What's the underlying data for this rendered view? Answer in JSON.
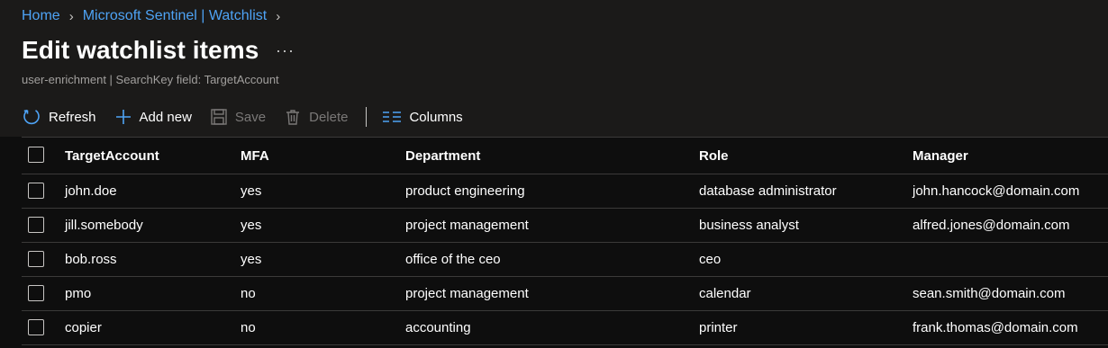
{
  "breadcrumb": {
    "items": [
      "Home",
      "Microsoft Sentinel | Watchlist"
    ]
  },
  "page": {
    "title": "Edit watchlist items",
    "more_label": "···",
    "subtitle": "user-enrichment | SearchKey field: TargetAccount"
  },
  "toolbar": {
    "refresh": "Refresh",
    "add_new": "Add new",
    "save": "Save",
    "delete": "Delete",
    "columns": "Columns",
    "accent_color": "#4ea3f5"
  },
  "table": {
    "columns": [
      "TargetAccount",
      "MFA",
      "Department",
      "Role",
      "Manager"
    ],
    "rows": [
      [
        "john.doe",
        "yes",
        "product engineering",
        "database administrator",
        "john.hancock@domain.com"
      ],
      [
        "jill.somebody",
        "yes",
        "project management",
        "business analyst",
        "alfred.jones@domain.com"
      ],
      [
        "bob.ross",
        "yes",
        "office of the ceo",
        "ceo",
        ""
      ],
      [
        "pmo",
        "no",
        "project management",
        "calendar",
        "sean.smith@domain.com"
      ],
      [
        "copier",
        "no",
        "accounting",
        "printer",
        "frank.thomas@domain.com"
      ]
    ]
  }
}
